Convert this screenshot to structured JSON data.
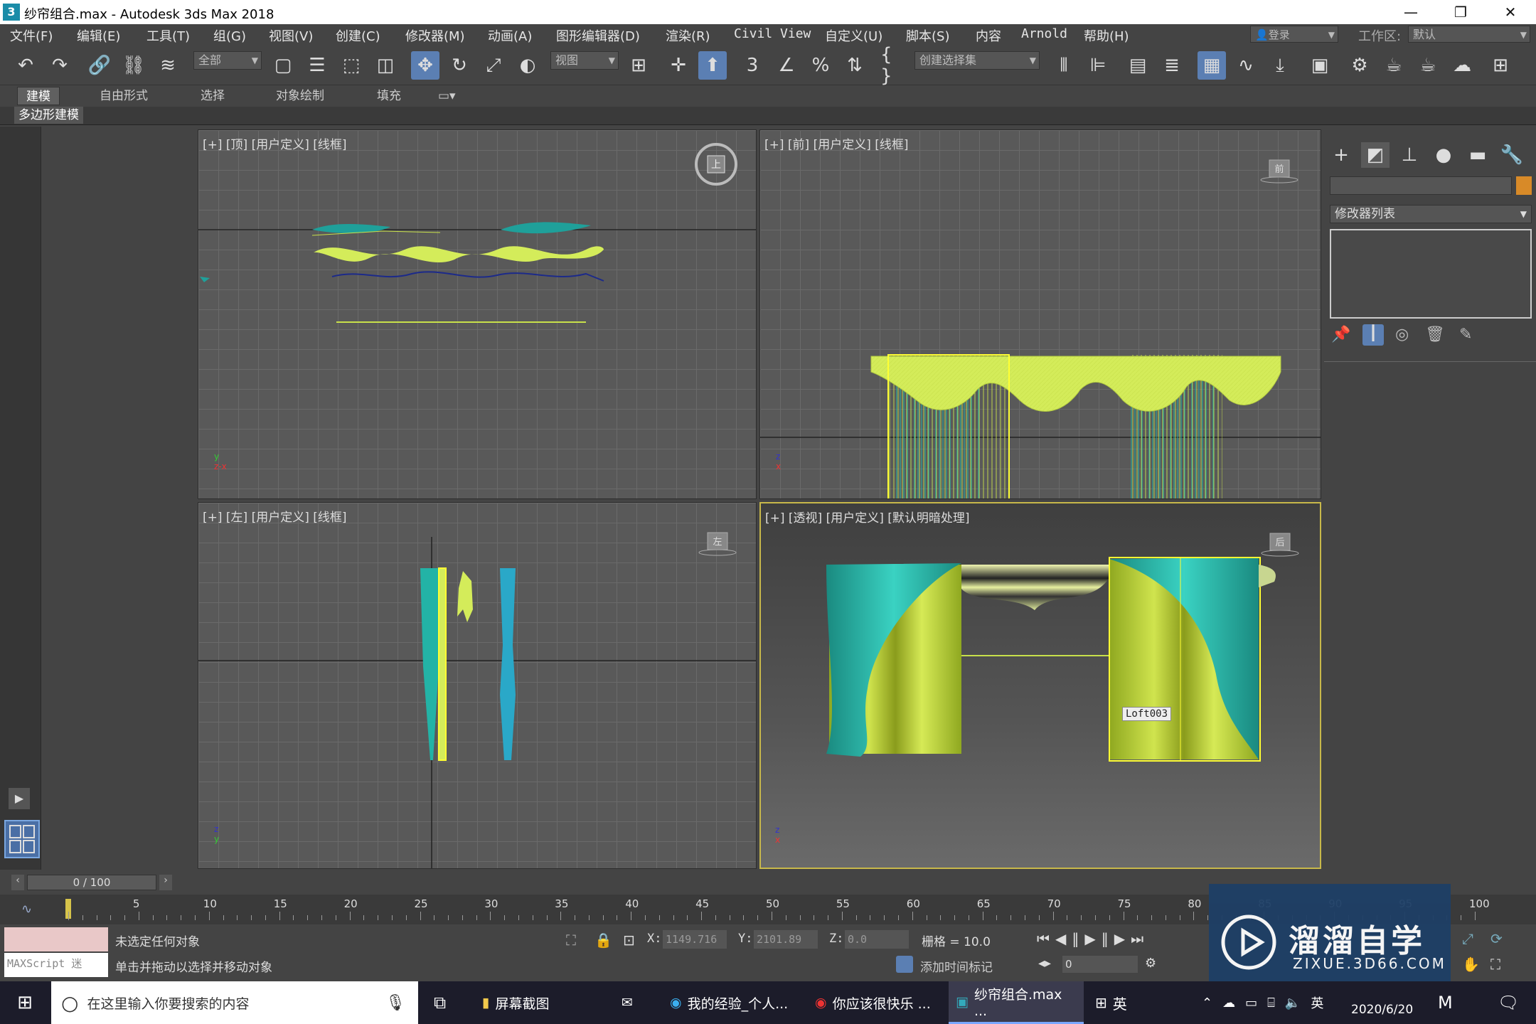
{
  "window": {
    "title": "纱帘组合.max - Autodesk 3ds Max 2018",
    "minimize": "—",
    "restore": "❐",
    "close": "✕"
  },
  "menu": [
    "文件(F)",
    "编辑(E)",
    "工具(T)",
    "组(G)",
    "视图(V)",
    "创建(C)",
    "修改器(M)",
    "动画(A)",
    "图形编辑器(D)",
    "渲染(R)",
    "Civil View",
    "自定义(U)",
    "脚本(S)",
    "内容",
    "Arnold",
    "帮助(H)"
  ],
  "menu_right": {
    "login": "登录",
    "workspace_label": "工作区:",
    "workspace_value": "默认"
  },
  "toolbar": {
    "filter_value": "全部",
    "refcoord_value": "视图",
    "selection_set_placeholder": "创建选择集"
  },
  "ribbon": {
    "tabs": [
      "建模",
      "自由形式",
      "选择",
      "对象绘制",
      "填充"
    ],
    "active_tab": "建模",
    "subtab": "多边形建模"
  },
  "viewports": {
    "top": {
      "label": "[+] [顶] [用户定义] [线框]",
      "cube": "上"
    },
    "front": {
      "label": "[+] [前] [用户定义] [线框]",
      "cube": "前"
    },
    "left": {
      "label": "[+] [左] [用户定义] [线框]",
      "cube": "左"
    },
    "persp": {
      "label": "[+] [透视] [用户定义] [默认明暗处理]",
      "cube": "后",
      "tooltip": "Loft003"
    }
  },
  "command_panel": {
    "modifier_list": "修改器列表"
  },
  "timeline": {
    "frame_display": "0 / 100",
    "ticks": [
      "5",
      "10",
      "15",
      "20",
      "25",
      "30",
      "35",
      "40",
      "45",
      "50",
      "55",
      "60",
      "65",
      "70",
      "75",
      "80",
      "85",
      "90",
      "95",
      "100"
    ]
  },
  "status": {
    "maxscript": "MAXScript 迷",
    "line1": "未选定任何对象",
    "line2": "单击并拖动以选择并移动对象",
    "x_label": "X:",
    "x_value": "1149.716",
    "y_label": "Y:",
    "y_value": "2101.89",
    "z_label": "Z:",
    "z_value": "0.0",
    "grid": "栅格 = 10.0",
    "add_time_tag": "添加时间标记",
    "frame_field": "0"
  },
  "taskbar": {
    "search_placeholder": "在这里输入你要搜索的内容",
    "items": [
      "屏幕截图",
      "我的经验_个人...",
      "你应该很快乐 ...",
      "纱帘组合.max ..."
    ],
    "ime": "英",
    "date": "2020/6/20"
  },
  "watermark": {
    "title": "溜溜自学",
    "url": "ZIXUE.3D66.COM"
  },
  "colors": {
    "curtain_green": "#c8e04a",
    "curtain_teal": "#23b3a6",
    "selection_yellow": "#ffff33",
    "viewport_bg": "#595959"
  }
}
